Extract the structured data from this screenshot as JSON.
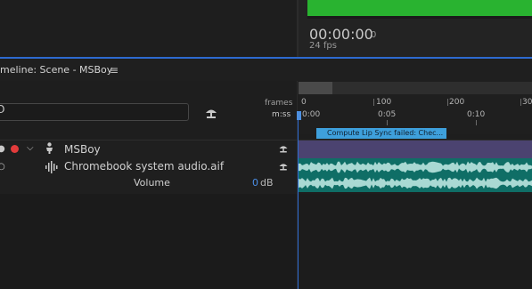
{
  "preview": {
    "timecode": "00:00:00",
    "timecode_frac": "0",
    "fps": "24 fps"
  },
  "timeline": {
    "panel_title": "meline: Scene - MSBoy",
    "menu_glyph": "≡",
    "search_value": "O",
    "frames_label": "frames",
    "mss_label": "m:ss",
    "frame_ticks": [
      "0",
      "100",
      "200",
      "30"
    ],
    "time_ticks": [
      "0:00",
      "0:05",
      "0:10"
    ],
    "warning": "Compute Lip Sync failed: Chec..."
  },
  "tracks": [
    {
      "name": "MSBoy",
      "type": "puppet"
    },
    {
      "name": "Chromebook system audio.aif",
      "type": "audio"
    }
  ],
  "volume": {
    "label": "Volume",
    "value": "0",
    "unit": "dB"
  },
  "colors": {
    "accent": "#2d6ad0",
    "stage_green": "#29b330",
    "puppet_bar": "#4b4370",
    "audio_bar": "#0f6e66",
    "warning_bg": "#3ea0dc",
    "record_red": "#e23b3b"
  }
}
